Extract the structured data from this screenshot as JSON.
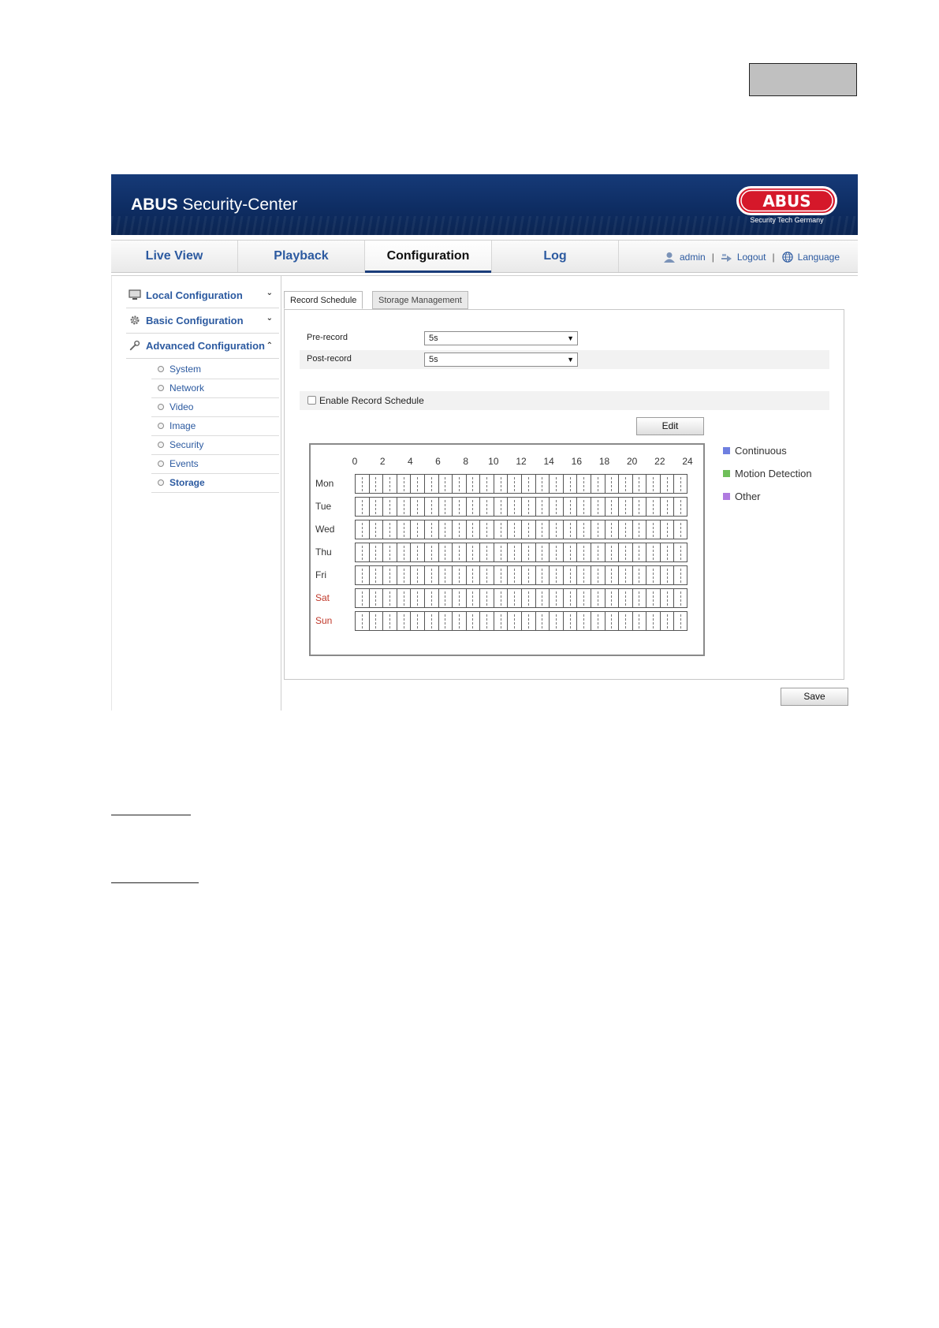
{
  "header": {
    "title_bold": "ABUS",
    "title_rest": " Security-Center",
    "logo_text": "ABUS",
    "logo_tagline": "Security Tech Germany"
  },
  "nav": {
    "tabs": [
      "Live View",
      "Playback",
      "Configuration",
      "Log"
    ],
    "active_tab": "Configuration",
    "user": "admin",
    "logout": "Logout",
    "language": "Language",
    "separator": "|"
  },
  "sidebar": {
    "groups": [
      {
        "label": "Local Configuration",
        "expanded": false
      },
      {
        "label": "Basic Configuration",
        "expanded": false
      },
      {
        "label": "Advanced Configuration",
        "expanded": true
      }
    ],
    "sub_items": [
      "System",
      "Network",
      "Video",
      "Image",
      "Security",
      "Events",
      "Storage"
    ],
    "active_sub_item": "Storage"
  },
  "tabs": {
    "items": [
      "Record Schedule",
      "Storage Management"
    ],
    "active": "Record Schedule"
  },
  "form": {
    "pre_record": {
      "label": "Pre-record",
      "value": "5s"
    },
    "post_record": {
      "label": "Post-record",
      "value": "5s"
    },
    "enable_schedule": {
      "label": "Enable Record Schedule",
      "checked": false
    },
    "edit_button": "Edit",
    "save_button": "Save"
  },
  "schedule": {
    "hours": [
      "0",
      "2",
      "4",
      "6",
      "8",
      "10",
      "12",
      "14",
      "16",
      "18",
      "20",
      "22",
      "24"
    ],
    "days": [
      {
        "label": "Mon",
        "weekend": false
      },
      {
        "label": "Tue",
        "weekend": false
      },
      {
        "label": "Wed",
        "weekend": false
      },
      {
        "label": "Thu",
        "weekend": false
      },
      {
        "label": "Fri",
        "weekend": false
      },
      {
        "label": "Sat",
        "weekend": true
      },
      {
        "label": "Sun",
        "weekend": true
      }
    ]
  },
  "legend": [
    {
      "label": "Continuous",
      "color": "#6f7fe0"
    },
    {
      "label": "Motion Detection",
      "color": "#6fbf5a"
    },
    {
      "label": "Other",
      "color": "#b07be0"
    }
  ],
  "colors": {
    "banner": "#0e2d63",
    "link": "#2c5aa0",
    "weekend": "#c0392b",
    "logo_red": "#d5182a"
  }
}
